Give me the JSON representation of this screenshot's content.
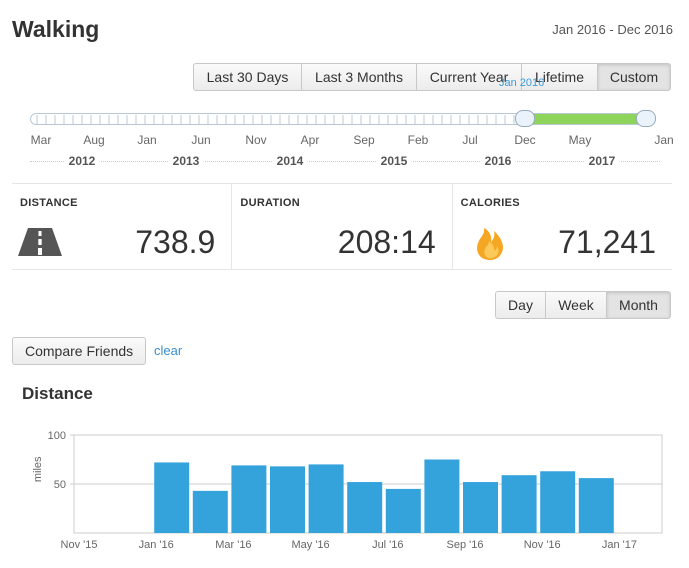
{
  "header": {
    "title": "Walking",
    "date_range": "Jan 2016 - Dec 2016"
  },
  "range_buttons": [
    "Last 30 Days",
    "Last 3 Months",
    "Current Year",
    "Lifetime",
    "Custom"
  ],
  "slider": {
    "tooltip": "Jan 2016",
    "months": [
      "Mar",
      "Aug",
      "Jan",
      "Jun",
      "Nov",
      "Apr",
      "Sep",
      "Feb",
      "Jul",
      "Dec",
      "May",
      "Jan"
    ],
    "years": [
      "2012",
      "2013",
      "2014",
      "2015",
      "2016",
      "2017"
    ],
    "range_color": "#8ed35a"
  },
  "stats": {
    "distance": {
      "label": "DISTANCE",
      "value": "738.9"
    },
    "duration": {
      "label": "DURATION",
      "value": "208:14"
    },
    "calories": {
      "label": "CALORIES",
      "value": "71,241"
    }
  },
  "period_buttons": [
    "Day",
    "Week",
    "Month"
  ],
  "compare": {
    "button": "Compare Friends",
    "clear": "clear"
  },
  "chart_title": "Distance",
  "chart_data": {
    "type": "bar",
    "ylabel": "miles",
    "ylim": [
      0,
      100
    ],
    "yticks": [
      50,
      100
    ],
    "x_tick_labels": [
      "Nov '15",
      "Jan '16",
      "Mar '16",
      "May '16",
      "Jul '16",
      "Sep '16",
      "Nov '16",
      "Jan '17"
    ],
    "categories": [
      "Jan",
      "Feb",
      "Mar",
      "Apr",
      "May",
      "Jun",
      "Jul",
      "Aug",
      "Sep",
      "Oct",
      "Nov",
      "Dec"
    ],
    "values": [
      72,
      43,
      69,
      68,
      70,
      52,
      45,
      75,
      52,
      59,
      63,
      56
    ],
    "bar_color": "#34a3dc"
  }
}
